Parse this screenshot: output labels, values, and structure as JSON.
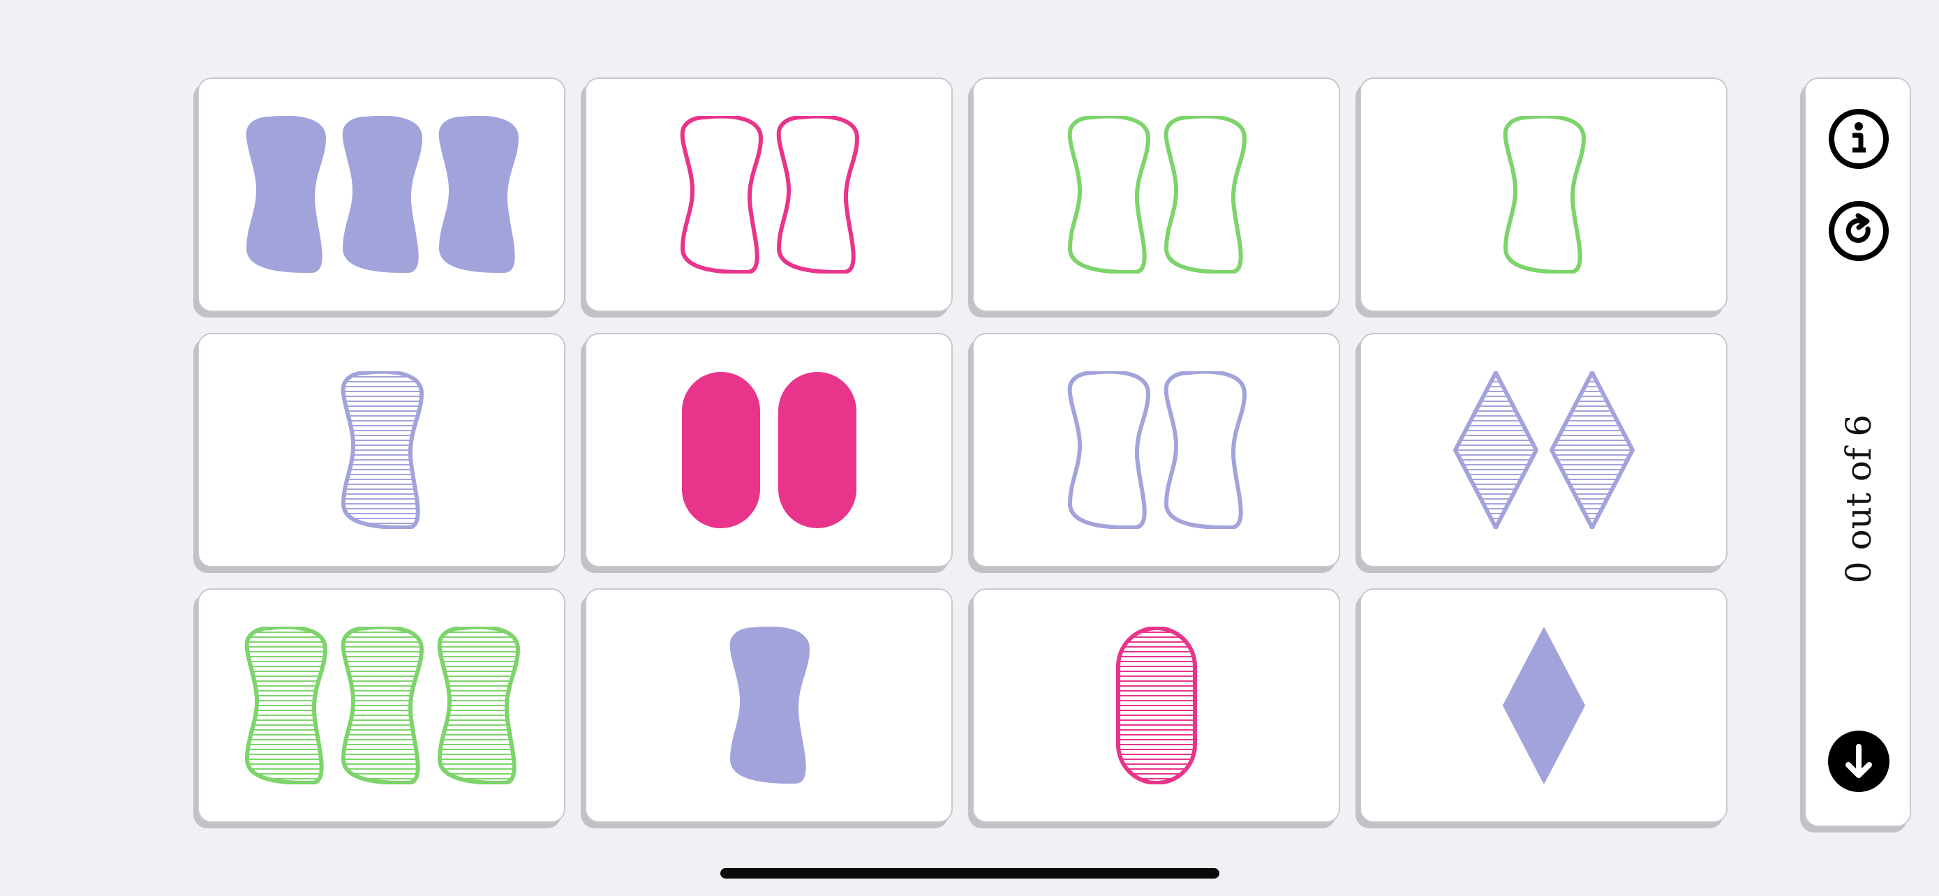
{
  "colors": {
    "purple": "#a3a3dc",
    "pink": "#e8348a",
    "green": "#7cd46a",
    "background": "#f1f0f5",
    "card": "#ffffff",
    "icon": "#000000"
  },
  "cards": [
    {
      "count": 3,
      "shape": "squiggle",
      "color": "purple",
      "fill": "solid"
    },
    {
      "count": 2,
      "shape": "squiggle",
      "color": "pink",
      "fill": "empty"
    },
    {
      "count": 2,
      "shape": "squiggle",
      "color": "green",
      "fill": "empty"
    },
    {
      "count": 1,
      "shape": "squiggle",
      "color": "green",
      "fill": "empty"
    },
    {
      "count": 1,
      "shape": "squiggle",
      "color": "purple",
      "fill": "striped"
    },
    {
      "count": 2,
      "shape": "oval",
      "color": "pink",
      "fill": "solid"
    },
    {
      "count": 2,
      "shape": "squiggle",
      "color": "purple",
      "fill": "empty"
    },
    {
      "count": 2,
      "shape": "diamond",
      "color": "purple",
      "fill": "striped"
    },
    {
      "count": 3,
      "shape": "squiggle",
      "color": "green",
      "fill": "striped"
    },
    {
      "count": 1,
      "shape": "squiggle",
      "color": "purple",
      "fill": "solid"
    },
    {
      "count": 1,
      "shape": "oval",
      "color": "pink",
      "fill": "striped"
    },
    {
      "count": 1,
      "shape": "diamond",
      "color": "purple",
      "fill": "solid"
    }
  ],
  "sidebar": {
    "score_text": "0 out of 6",
    "info_icon": "info-circle-icon",
    "restart_icon": "restart-circle-icon",
    "download_icon": "arrow-down-circle-icon"
  }
}
